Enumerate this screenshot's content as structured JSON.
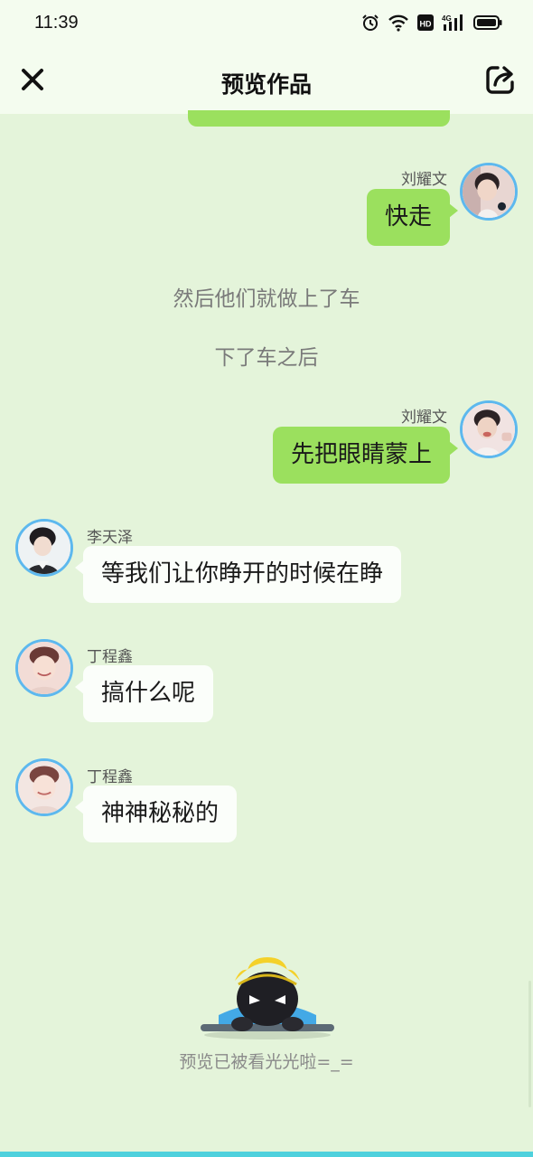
{
  "status_bar": {
    "time": "11:39",
    "icons": [
      "alarm-icon",
      "wifi-icon",
      "hd-icon",
      "signal-4g-icon",
      "battery-icon"
    ],
    "network_label": "4G",
    "hd_label": "HD"
  },
  "nav": {
    "title": "预览作品",
    "close_icon": "close-icon",
    "share_icon": "share-icon"
  },
  "colors": {
    "background": "#e4f4da",
    "header_bg": "#f4fcef",
    "bubble_green": "#9be05e",
    "bubble_white": "#fbfefa",
    "avatar_border": "#5db8ee"
  },
  "messages": [
    {
      "type": "chat",
      "side": "right",
      "sender": "刘耀文",
      "text": "快走"
    },
    {
      "type": "narration",
      "text": "然后他们就做上了车"
    },
    {
      "type": "narration",
      "text": "下了车之后"
    },
    {
      "type": "chat",
      "side": "right",
      "sender": "刘耀文",
      "text": "先把眼睛蒙上"
    },
    {
      "type": "chat",
      "side": "left",
      "sender": "李天泽",
      "text": "等我们让你睁开的时候在睁"
    },
    {
      "type": "chat",
      "side": "left",
      "sender": "丁程鑫",
      "text": "搞什么呢"
    },
    {
      "type": "chat",
      "side": "left",
      "sender": "丁程鑫",
      "text": "神神秘秘的"
    }
  ],
  "footer": {
    "end_text": "预览已被看光光啦=_="
  }
}
